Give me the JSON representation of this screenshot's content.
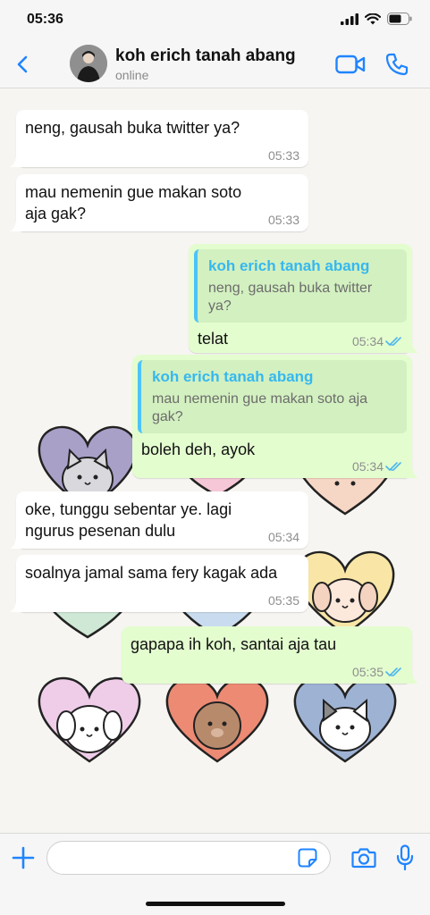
{
  "status_bar": {
    "time": "05:36"
  },
  "header": {
    "contact_name": "koh erich tanah abang",
    "contact_status": "online"
  },
  "messages": [
    {
      "direction": "in",
      "text": "neng, gausah buka twitter ya?",
      "time": "05:33"
    },
    {
      "direction": "in",
      "text": "mau nemenin gue makan soto aja gak?",
      "time": "05:33"
    },
    {
      "direction": "out",
      "quote_name": "koh erich tanah abang",
      "quote_text": "neng, gausah buka twitter ya?",
      "text": "telat",
      "time": "05:34",
      "status": "read"
    },
    {
      "direction": "out",
      "quote_name": "koh erich tanah abang",
      "quote_text": "mau nemenin gue makan soto aja gak?",
      "text": "boleh deh, ayok",
      "time": "05:34",
      "status": "read"
    },
    {
      "direction": "in",
      "text": "oke, tunggu sebentar ye. lagi ngurus pesenan dulu",
      "time": "05:34"
    },
    {
      "direction": "in",
      "text": "soalnya jamal sama fery kagak ada",
      "time": "05:35"
    },
    {
      "direction": "out",
      "text": "gapapa ih koh, santai aja tau",
      "time": "05:35",
      "status": "read"
    }
  ],
  "input": {
    "value": "",
    "placeholder": ""
  },
  "colors": {
    "accent": "#1f84ff",
    "incoming_bubble": "#ffffff",
    "outgoing_bubble": "#e3fdcf",
    "quote_bar": "#4fc3f7",
    "read_tick": "#4fb6ec",
    "chat_background": "#f6f5f1"
  },
  "icons": {
    "back": "chevron-left-icon",
    "video_call": "video-camera-icon",
    "voice_call": "phone-icon",
    "attach": "plus-icon",
    "sticker": "sticker-icon",
    "camera": "camera-icon",
    "mic": "microphone-icon",
    "read_receipt": "double-check-icon"
  }
}
